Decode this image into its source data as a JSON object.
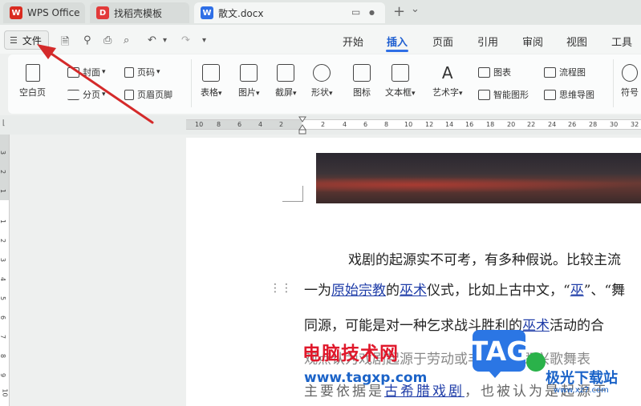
{
  "tabs": [
    {
      "label": "WPS Office",
      "icon": "wps-logo-icon",
      "color": "#d92b20"
    },
    {
      "label": "找稻壳模板",
      "icon": "docer-icon",
      "color": "#e23a3a"
    },
    {
      "label": "散文.docx",
      "icon": "word-doc-icon",
      "color": "#2f6fe6"
    }
  ],
  "tab_controls": {
    "add": "+",
    "dropdown": "⌄",
    "monitor": "▭",
    "dot": "●"
  },
  "file_menu": {
    "label": "文件"
  },
  "menu_tabs": [
    "开始",
    "插入",
    "页面",
    "引用",
    "审阅",
    "视图",
    "工具"
  ],
  "active_menu_tab": "插入",
  "ribbon": {
    "blank_page": "空白页",
    "cover": "封面",
    "page_number": "页码",
    "section_break": "分页",
    "header_footer": "页眉页脚",
    "table": "表格",
    "picture": "图片",
    "screenshot": "截屏",
    "shape": "形状",
    "icon": "图标",
    "textbox": "文本框",
    "art_text": "艺术字",
    "chart": "图表",
    "smart_graphic": "智能图形",
    "flowchart": "流程图",
    "mind_map": "思维导图",
    "symbol": "符号"
  },
  "ruler": {
    "numbers": [
      "10",
      "8",
      "6",
      "4",
      "2",
      "2",
      "4",
      "6",
      "8",
      "10",
      "12",
      "14",
      "16",
      "18",
      "20",
      "22",
      "24",
      "26",
      "28",
      "30",
      "32"
    ]
  },
  "vruler": {
    "numbers": [
      "3",
      "2",
      "1",
      "1",
      "2",
      "3",
      "4",
      "5",
      "6",
      "7",
      "8",
      "9",
      "10",
      "11",
      "12"
    ]
  },
  "document": {
    "line1": "戏剧的起源实不可考，有多种假说。比较主流",
    "line2_pre": "一为",
    "line2_link1": "原始宗教",
    "line2_mid": "的",
    "line2_link2": "巫术",
    "line2_post": "仪式，比如上古中文，“",
    "line2_link3": "巫",
    "line2_end": "”、“舞",
    "line3_pre": "同源，可能是对一种乞求战斗胜利的",
    "line3_link": "巫术",
    "line3_post": "活动的合",
    "line4": "观点认为戏剧起源于劳动或丰收时的即兴歌舞表",
    "line5_pre": "主要依据是",
    "line5_link": "古希腊戏剧",
    "line5_post": "，也被认为是起源于"
  },
  "watermark": {
    "cn_name": "电脑技术网",
    "url": "www.tagxp.com",
    "tag": "TAG",
    "site_cn": "极光下载站",
    "site_url": "www.xz7.com"
  }
}
